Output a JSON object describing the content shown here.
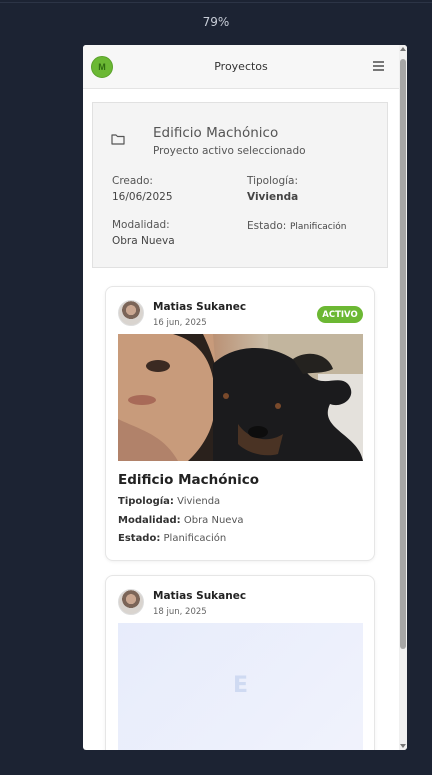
{
  "browser": {
    "zoom": "79%"
  },
  "app": {
    "avatar_initial": "M",
    "title": "Proyectos",
    "accent_color": "#6bb834"
  },
  "selected_project": {
    "name": "Edificio Machónico",
    "subtitle": "Proyecto activo seleccionado",
    "created_label": "Creado:",
    "created_value": "16/06/2025",
    "typology_label": "Tipología:",
    "typology_value": "Vivienda",
    "mode_label": "Modalidad:",
    "mode_value": "Obra Nueva",
    "state_label": "Estado:",
    "state_value": "Planificación"
  },
  "cards": [
    {
      "user": "Matias Sukanec",
      "date": "16 jun, 2025",
      "badge": "ACTIVO",
      "title": "Edificio Machónico",
      "typology_label": "Tipología:",
      "typology_value": "Vivienda",
      "mode_label": "Modalidad:",
      "mode_value": "Obra Nueva",
      "state_label": "Estado:",
      "state_value": "Planificación"
    },
    {
      "user": "Matias Sukanec",
      "date": "18 jun, 2025",
      "placeholder_letter": "E"
    }
  ]
}
